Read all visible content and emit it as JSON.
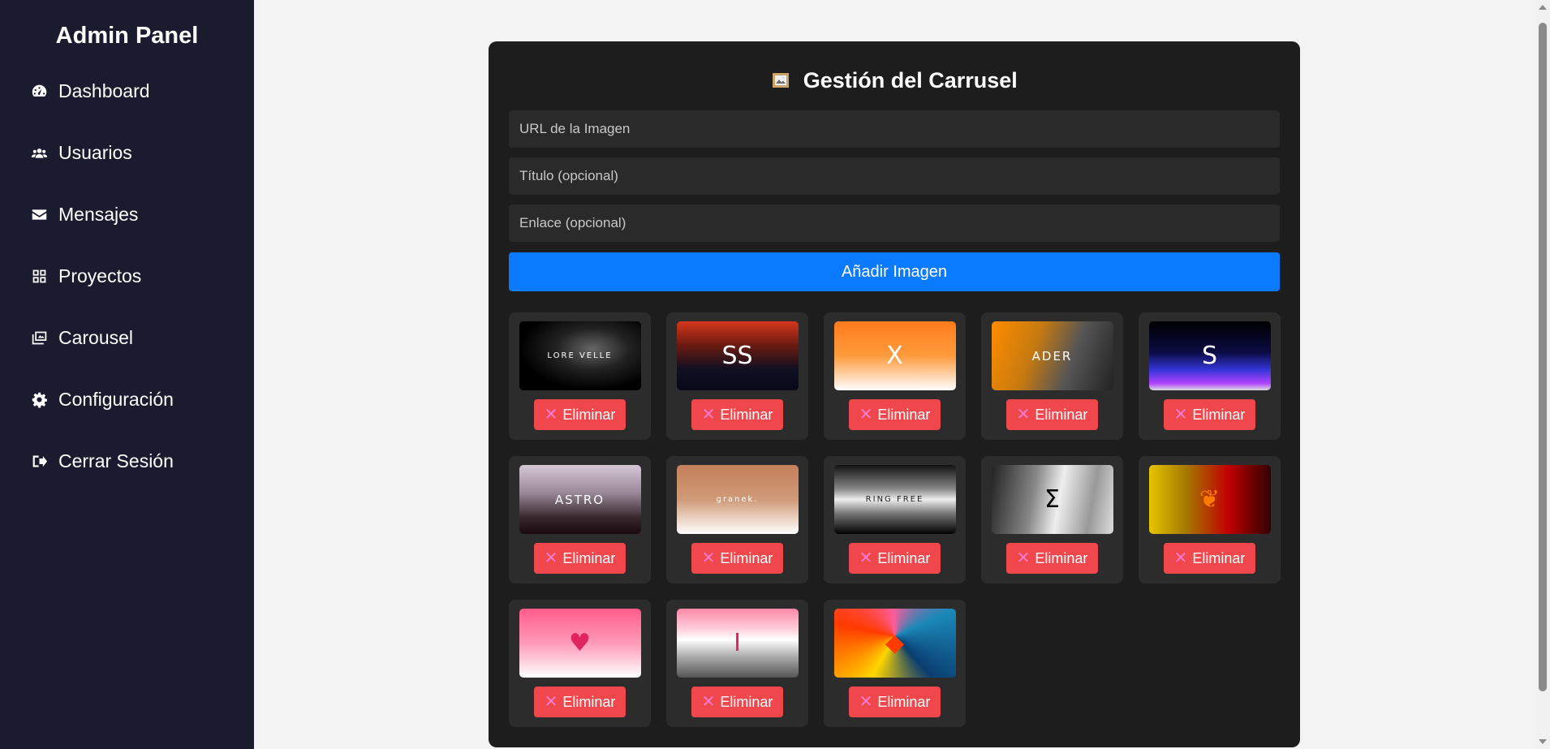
{
  "sidebar": {
    "title": "Admin Panel",
    "items": [
      {
        "label": "Dashboard",
        "icon": "gauge-icon"
      },
      {
        "label": "Usuarios",
        "icon": "users-icon"
      },
      {
        "label": "Mensajes",
        "icon": "envelope-icon"
      },
      {
        "label": "Proyectos",
        "icon": "grid-icon"
      },
      {
        "label": "Carousel",
        "icon": "images-icon"
      },
      {
        "label": "Configuración",
        "icon": "gear-icon"
      },
      {
        "label": "Cerrar Sesión",
        "icon": "sign-out-icon"
      }
    ]
  },
  "panel": {
    "title": "Gestión del Carrusel",
    "url_placeholder": "URL de la Imagen",
    "title_placeholder": "Título (opcional)",
    "link_placeholder": "Enlace (opcional)",
    "add_label": "Añadir Imagen"
  },
  "images": [
    {
      "label": "LORE VELLE",
      "delete_label": "Eliminar",
      "bg": "radial-gradient(ellipse at 60% 40%, #666 0%, #222 35%, #000 70%)",
      "fg": "#fff"
    },
    {
      "label": "SS",
      "delete_label": "Eliminar",
      "bg": "linear-gradient(#d6371c 0%, #6a1a10 35%, #0f0f22 70%, #080818 100%)",
      "fg": "#fff"
    },
    {
      "label": "X",
      "delete_label": "Eliminar",
      "bg": "linear-gradient(#ff7b1c 0%, #ff9b3d 50%, #fff 100%)",
      "fg": "#fff"
    },
    {
      "label": "ADER",
      "delete_label": "Eliminar",
      "bg": "linear-gradient(110deg, #ff8c00 0%, #c67a10 35%, #555 65%, #222 100%)",
      "fg": "#fff"
    },
    {
      "label": "S",
      "delete_label": "Eliminar",
      "bg": "linear-gradient(#000 0%, #0b0b44 45%, #3434d6 70%, #b044ff 90%, #ddd 100%)",
      "fg": "#fff"
    },
    {
      "label": "ASTRO",
      "delete_label": "Eliminar",
      "bg": "linear-gradient(#d6c7d6 0%, #9a8a99 40%, #3a2a30 75%, #1a0a10 100%)",
      "fg": "#fff"
    },
    {
      "label": "granek.",
      "delete_label": "Eliminar",
      "bg": "linear-gradient(#c4805a 0%, #d09a78 50%, #fff 100%)",
      "fg": "#fff"
    },
    {
      "label": "RING FREE",
      "delete_label": "Eliminar",
      "bg": "linear-gradient(#111 0%, #888 35%, #eee 50%, #777 70%, #000 100%)",
      "fg": "#222"
    },
    {
      "label": "Σ",
      "delete_label": "Eliminar",
      "bg": "linear-gradient(100deg, #222 0%, #888 35%, #eee 55%, #999 80%, #ddd 100%)",
      "fg": "#000"
    },
    {
      "label": "❦",
      "delete_label": "Eliminar",
      "bg": "linear-gradient(90deg, #e6c400 0%, #a57a00 30%, #c00000 65%, #300000 100%)",
      "fg": "#ff7a00"
    },
    {
      "label": "♥",
      "delete_label": "Eliminar",
      "bg": "linear-gradient(#ff5b8a 0%, #ff9ab8 50%, #fff 100%)",
      "fg": "#e0245e"
    },
    {
      "label": "Ⅰ",
      "delete_label": "Eliminar",
      "bg": "linear-gradient(#ff88a8 0%, #ffd0dc 30%, #fff 45%, #aaa 70%, #555 100%)",
      "fg": "#e0245e"
    },
    {
      "label": "◆",
      "delete_label": "Eliminar",
      "bg": "conic-gradient(from 210deg at 50% 40%, #ffd600, #ff3b00, #ff5b9a, #1a88b8, #0a3d70, #ffd600)",
      "fg": "#ff3b00"
    }
  ],
  "colors": {
    "sidebar_bg": "#1b1b30",
    "panel_bg": "#1d1d1d",
    "primary": "#0a7bff",
    "danger": "#f0474d"
  }
}
